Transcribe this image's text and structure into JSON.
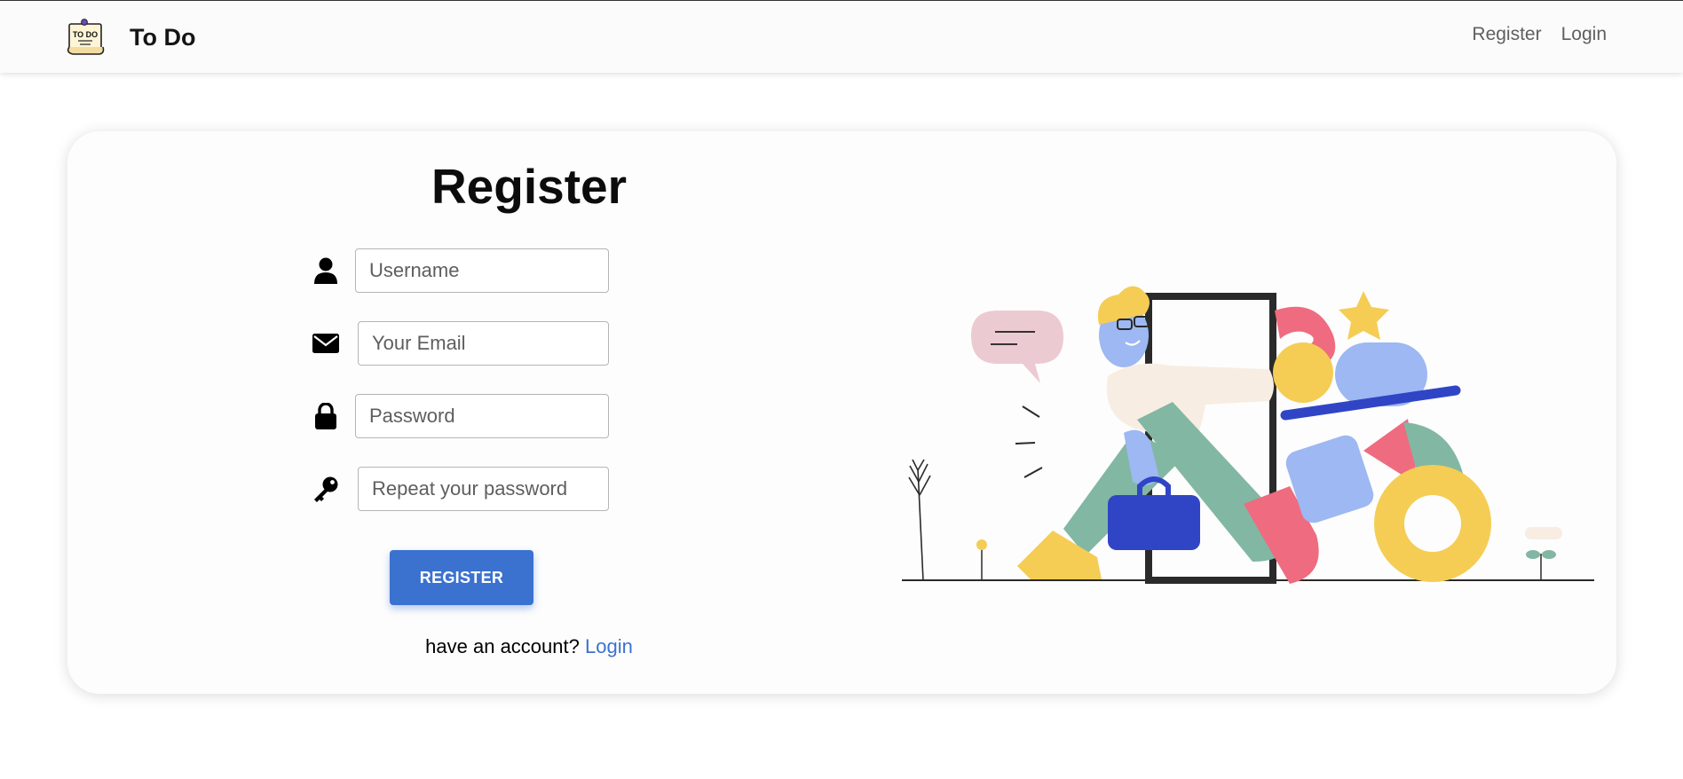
{
  "navbar": {
    "brand_text": "To Do",
    "logo_text": "TO DO",
    "links": {
      "register": "Register",
      "login": "Login"
    }
  },
  "form": {
    "title": "Register",
    "fields": {
      "username": {
        "placeholder": "Username",
        "value": "",
        "icon": "user-icon"
      },
      "email": {
        "placeholder": "Your Email",
        "value": "",
        "icon": "envelope-icon"
      },
      "password": {
        "placeholder": "Password",
        "value": "",
        "icon": "lock-icon"
      },
      "repeat_password": {
        "placeholder": "Repeat your password",
        "value": "",
        "icon": "key-icon"
      }
    },
    "submit_label": "REGISTER",
    "footer": {
      "prompt": "have an account? ",
      "link_label": "Login"
    }
  },
  "colors": {
    "accent": "#3b72d0",
    "navbar_bg": "#fbfbfb"
  }
}
